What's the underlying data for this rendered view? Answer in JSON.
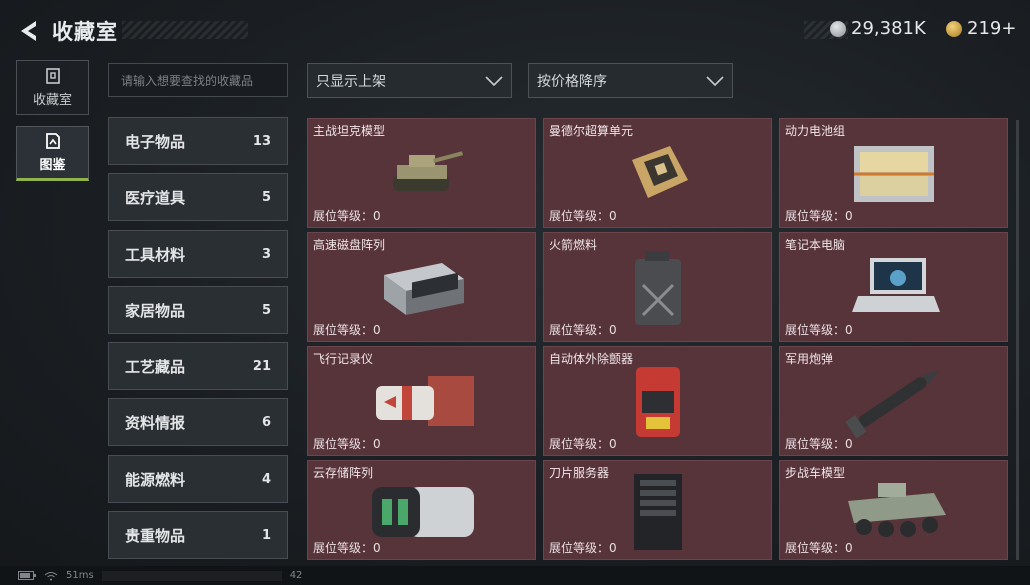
{
  "header": {
    "title": "收藏室",
    "currency": [
      {
        "icon": "silver-coin-icon",
        "value": "29,381K",
        "color": "#b8bcc0"
      },
      {
        "icon": "gold-coin-icon",
        "value": "219+",
        "color": "#d4a645"
      }
    ]
  },
  "nav": {
    "items": [
      {
        "label": "收藏室",
        "icon": "collection-room-icon",
        "active": false
      },
      {
        "label": "图鉴",
        "icon": "catalog-icon",
        "active": true
      }
    ]
  },
  "search": {
    "placeholder": "请输入想要查找的收藏品"
  },
  "filters": {
    "shelf": "只显示上架",
    "sort": "按价格降序"
  },
  "categories": [
    {
      "label": "电子物品",
      "count": "13"
    },
    {
      "label": "医疗道具",
      "count": "5"
    },
    {
      "label": "工具材料",
      "count": "3"
    },
    {
      "label": "家居物品",
      "count": "5"
    },
    {
      "label": "工艺藏品",
      "count": "21"
    },
    {
      "label": "资料情报",
      "count": "6"
    },
    {
      "label": "能源燃料",
      "count": "4"
    },
    {
      "label": "贵重物品",
      "count": "1"
    }
  ],
  "items": [
    {
      "name": "主战坦克模型",
      "level": "展位等级：0",
      "icon": "tank-model-icon"
    },
    {
      "name": "曼德尔超算单元",
      "level": "展位等级：0",
      "icon": "supercomputer-unit-icon"
    },
    {
      "name": "动力电池组",
      "level": "展位等级：0",
      "icon": "battery-pack-icon"
    },
    {
      "name": "高速磁盘阵列",
      "level": "展位等级：0",
      "icon": "disk-array-icon"
    },
    {
      "name": "火箭燃料",
      "level": "展位等级：0",
      "icon": "fuel-canister-icon"
    },
    {
      "name": "笔记本电脑",
      "level": "展位等级：0",
      "icon": "laptop-icon"
    },
    {
      "name": "飞行记录仪",
      "level": "展位等级：0",
      "icon": "flight-recorder-icon"
    },
    {
      "name": "自动体外除颤器",
      "level": "展位等级：0",
      "icon": "defibrillator-icon"
    },
    {
      "name": "军用炮弹",
      "level": "展位等级：0",
      "icon": "artillery-shell-icon"
    },
    {
      "name": "云存储阵列",
      "level": "展位等级：0",
      "icon": "cloud-storage-icon"
    },
    {
      "name": "刀片服务器",
      "level": "展位等级：0",
      "icon": "blade-server-icon"
    },
    {
      "name": "步战车模型",
      "level": "展位等级：0",
      "icon": "ifv-model-icon"
    }
  ],
  "status": {
    "ping": "51ms",
    "fps": "42"
  },
  "colors": {
    "card_bg": "#57333a",
    "accent": "#8fb54a"
  }
}
